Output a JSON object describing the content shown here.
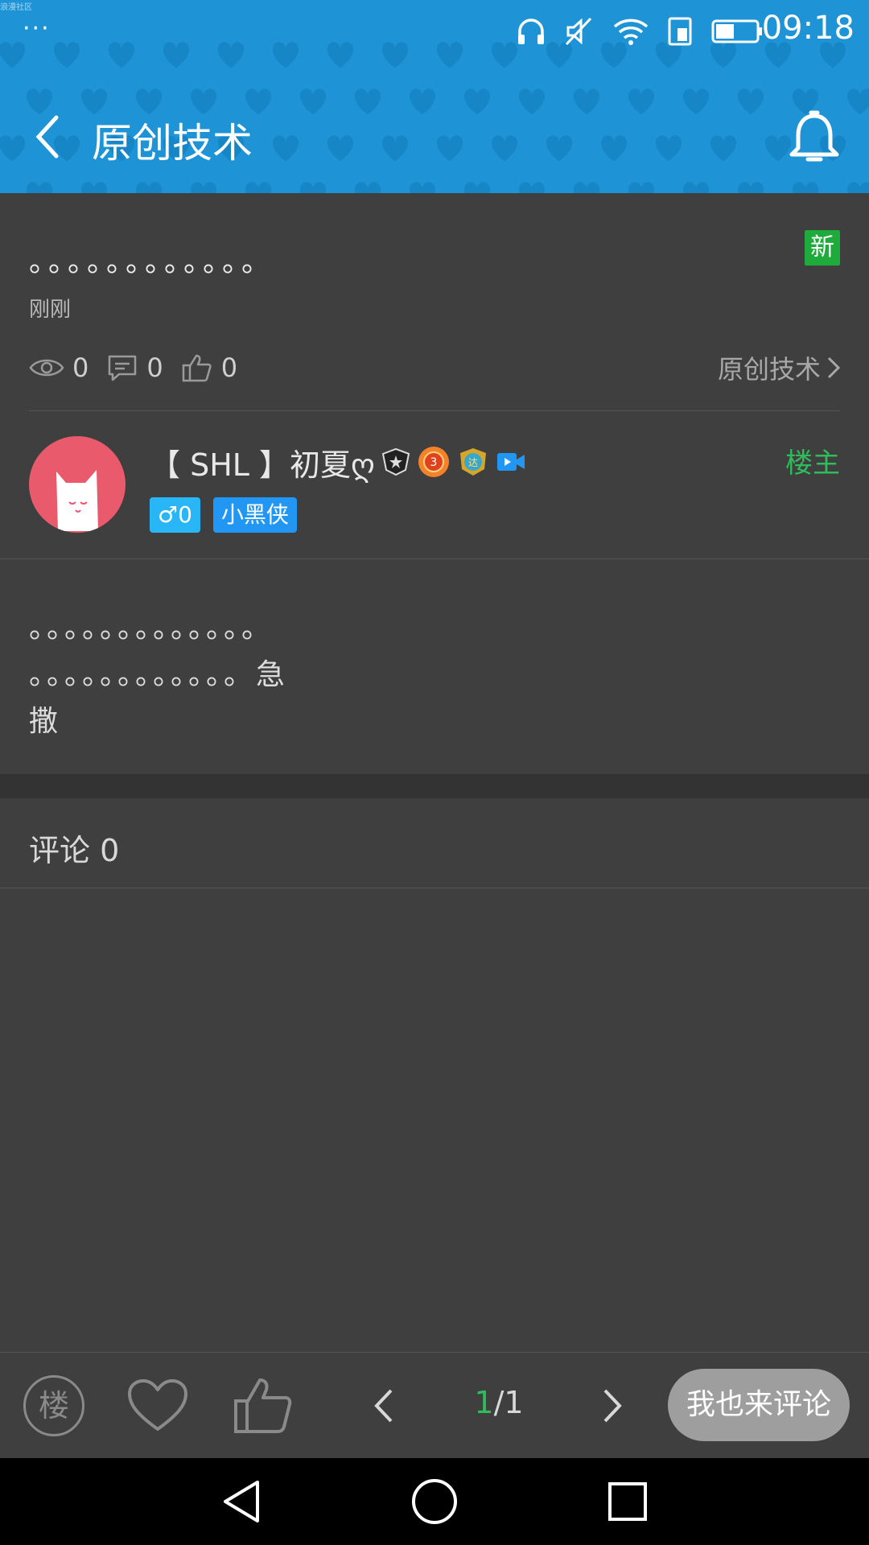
{
  "status_bar": {
    "app_label": "浪漫社区",
    "more_dots": "···",
    "time": "09:18",
    "icons": [
      "headphones-icon",
      "mute-icon",
      "wifi-icon",
      "sim-icon",
      "battery-icon"
    ]
  },
  "header": {
    "title": "原创技术",
    "back_icon": "chevron-left-icon",
    "bell_icon": "bell-icon",
    "color": "#1e93d6"
  },
  "post": {
    "title": "。。。。。。。。。。。。",
    "new_badge": "新",
    "time": "刚刚",
    "views": "0",
    "comments": "0",
    "likes": "0",
    "category": "原创技术"
  },
  "author": {
    "name": "【 SHL 】初夏ღ",
    "owner_tag": "楼主",
    "gender_tag": "♂0",
    "level_tag": "小黑侠",
    "medals": [
      "shield-medal-icon",
      "level-3-medal-icon",
      "expert-medal-icon",
      "video-badge-icon"
    ]
  },
  "body": {
    "line1": "。。。。。。。。。。。。。",
    "line2": "。。。。。。。。。。。。急",
    "line3": "撒"
  },
  "comments": {
    "label": "评论 0"
  },
  "bottom_bar": {
    "floor_label": "楼",
    "page_current": "1",
    "page_total": "/1",
    "comment_button": "我也来评论"
  },
  "colors": {
    "accent_green": "#2ebd5a",
    "background": "#3f3f3f"
  }
}
